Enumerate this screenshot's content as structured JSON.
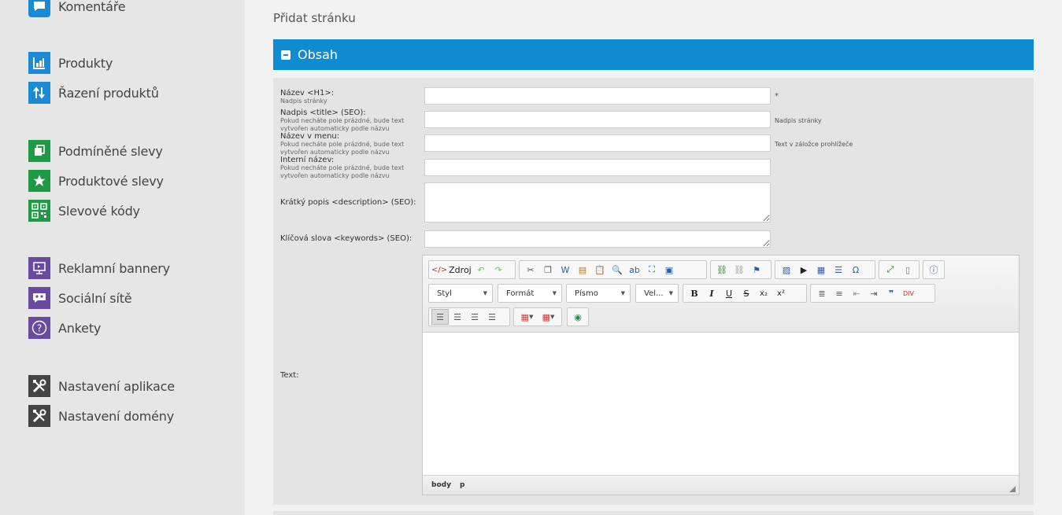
{
  "sidebar": {
    "items": [
      {
        "label": "Komentáře",
        "icon": "comment-icon",
        "color": "#1a8ad4"
      },
      {
        "label": "Produkty",
        "icon": "products-chart-icon",
        "color": "#1a8ad4"
      },
      {
        "label": "Řazení produktů",
        "icon": "sort-arrows-icon",
        "color": "#1a8ad4"
      },
      {
        "label": "Podmíněné slevy",
        "icon": "conditional-discount-icon",
        "color": "#1e9a44"
      },
      {
        "label": "Produktové slevy",
        "icon": "star-icon",
        "color": "#1e9a44"
      },
      {
        "label": "Slevové kódy",
        "icon": "qr-code-icon",
        "color": "#1e9a44"
      },
      {
        "label": "Reklamní bannery",
        "icon": "banner-monitor-icon",
        "color": "#6a4a9e"
      },
      {
        "label": "Sociální sítě",
        "icon": "social-people-icon",
        "color": "#6a4a9e"
      },
      {
        "label": "Ankety",
        "icon": "question-icon",
        "color": "#6a4a9e"
      },
      {
        "label": "Nastavení aplikace",
        "icon": "tools-icon",
        "color": "#444444"
      },
      {
        "label": "Nastavení domény",
        "icon": "tools-icon",
        "color": "#444444"
      }
    ]
  },
  "page": {
    "title": "Přidat stránku",
    "section_title": "Obsah"
  },
  "form": {
    "h1_label": "Název <H1>:",
    "h1_sub": "Nadpis stránky",
    "h1_value": "",
    "h1_required": "*",
    "title_label": "Nadpis <title> (SEO):",
    "title_sub": "Pokud necháte pole prázdné, bude text vytvořen automaticky podle názvu",
    "title_value": "",
    "title_hint": "Nadpis stránky",
    "menu_label": "Název v menu:",
    "menu_sub": "Pokud necháte pole prázdné, bude text vytvořen automaticky podle názvu",
    "menu_value": "",
    "menu_hint": "Text v záložce prohlížeče",
    "internal_label": "Interní název:",
    "internal_sub": "Pokud necháte pole prázdné, bude text vytvořen automaticky podle názvu",
    "internal_value": "",
    "description_label": "Krátký popis <description> (SEO):",
    "description_value": "",
    "keywords_label": "Klíčová slova <keywords> (SEO):",
    "keywords_value": "",
    "text_label": "Text:"
  },
  "editor": {
    "source_label": "Zdroj",
    "style_combo": "Styl",
    "format_combo": "Formát",
    "font_combo": "Písmo",
    "size_combo": "Vel...",
    "bold": "B",
    "italic": "I",
    "underline": "U",
    "strike": "S",
    "path": [
      "body",
      "p"
    ]
  },
  "colors": {
    "accent": "#0f8bd1"
  }
}
